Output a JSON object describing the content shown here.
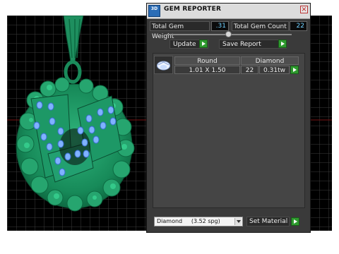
{
  "panel": {
    "title": "GEM REPORTER",
    "app_icon_text": "3D",
    "close_glyph": "×",
    "total_weight_label": "Total Gem Weight",
    "total_weight_value": ".31",
    "total_count_label": "Total Gem Count",
    "total_count_value": "22",
    "update_label": "Update",
    "save_report_label": "Save Report",
    "columns": [
      "Round",
      "Diamond"
    ],
    "rows": [
      {
        "size": "1.01 X 1.50",
        "count": "22",
        "weight": "0.31tw"
      }
    ],
    "material_select": "Diamond     (3.52 spg)",
    "set_material_label": "Set Material"
  },
  "colors": {
    "model_green": "#1f8a5e",
    "gem_blue": "#7fb2ff",
    "value_blue": "#6fd0ff",
    "go_green": "#2e9a2e"
  },
  "icons": [
    "gem-reporter-app-icon",
    "close-icon",
    "play-arrow-icon",
    "dropdown-arrow-icon",
    "round-gem-icon"
  ]
}
